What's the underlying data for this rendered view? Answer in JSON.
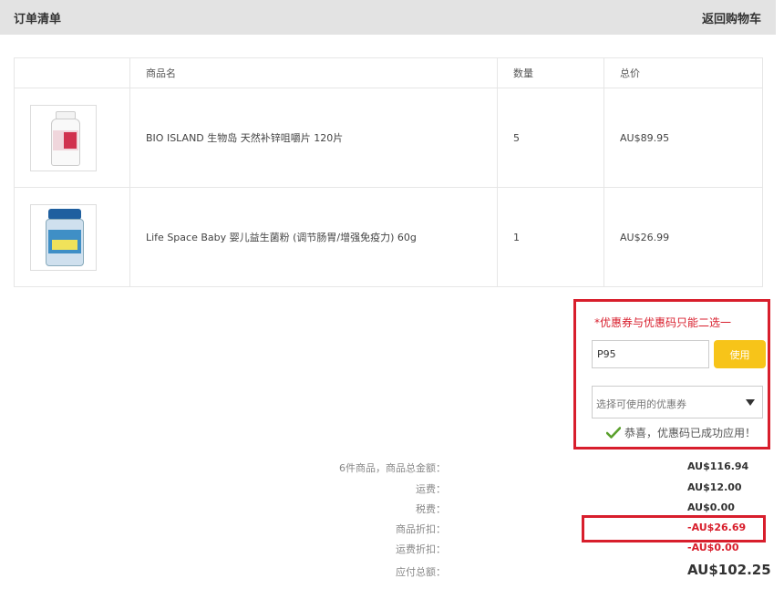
{
  "header": {
    "title": "订单清单",
    "back_link": "返回购物车"
  },
  "table": {
    "columns": [
      "",
      "商品名",
      "数量",
      "总价"
    ],
    "rows": [
      {
        "name": "BIO ISLAND 生物岛 天然补锌咀嚼片 120片",
        "qty": "5",
        "total": "AU$89.95"
      },
      {
        "name": "Life Space Baby 婴儿益生菌粉 (调节肠胃/增强免疫力) 60g",
        "qty": "1",
        "total": "AU$26.99"
      }
    ]
  },
  "coupon": {
    "notice": "*优惠券与优惠码只能二选一",
    "code_value": "P95",
    "use_button": "使用",
    "select_placeholder": "选择可使用的优惠券",
    "success_message": "恭喜，优惠码已成功应用！"
  },
  "summary": {
    "goods_label": "6件商品，商品总金额：",
    "goods_value": "AU$116.94",
    "shipping_label": "运费：",
    "shipping_value": "AU$12.00",
    "tax_label": "税费：",
    "tax_value": "AU$0.00",
    "discount_label": "商品折扣：",
    "discount_value": "-AU$26.69",
    "ship_discount_label": "运费折扣：",
    "ship_discount_value": "-AU$0.00",
    "total_label": "应付总额：",
    "total_value": "AU$102.25"
  },
  "colors": {
    "accent_red": "#d81e2c",
    "button_yellow": "#f7c419",
    "check_green": "#5aa02c"
  }
}
